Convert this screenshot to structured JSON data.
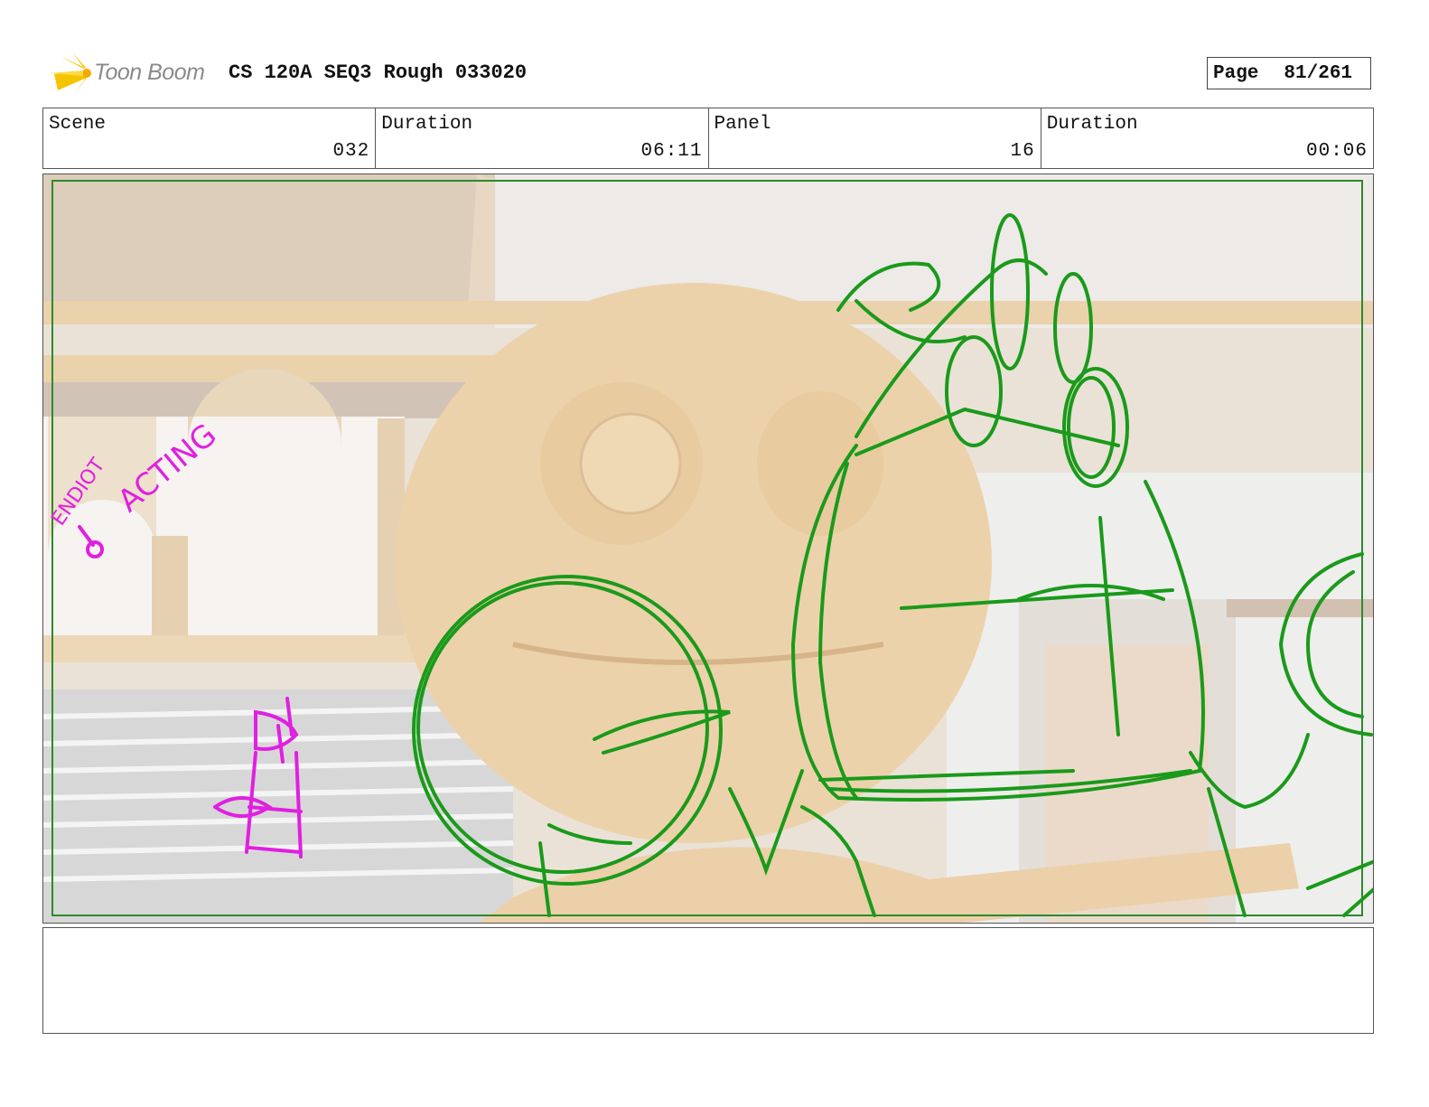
{
  "header": {
    "logo_text": "Toon Boom",
    "document_title": "CS 120A SEQ3 Rough 033020",
    "page_label": "Page",
    "page_number": "81/261"
  },
  "info": {
    "scene_label": "Scene",
    "scene_value": "032",
    "scene_duration_label": "Duration",
    "scene_duration_value": "06:11",
    "panel_label": "Panel",
    "panel_value": "16",
    "panel_duration_label": "Duration",
    "panel_duration_value": "00:06"
  },
  "panel": {
    "annotation_top": "ACTING",
    "annotation_side": "ENDIOT",
    "sketch_color": "#1a9a1a",
    "annotation_color": "#e020e0"
  },
  "notes": {
    "text": ""
  }
}
